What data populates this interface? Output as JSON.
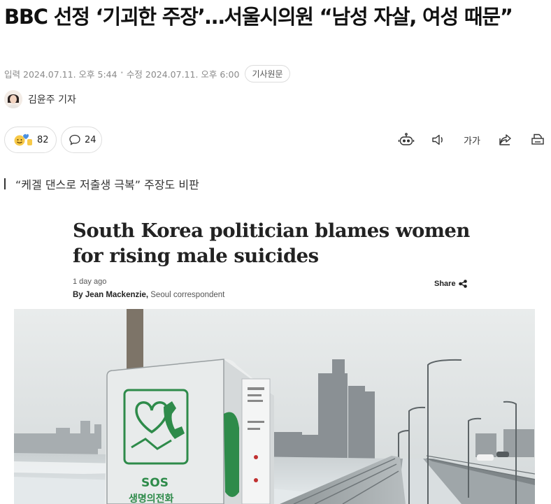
{
  "headline": "BBC 선정 ‘기괴한 주장’…서울시의원 “남성 자살, 여성 때문”",
  "meta": {
    "input_label": "입력",
    "input_time": "2024.07.11. 오후 5:44",
    "modified_label": "수정",
    "modified_time": "2024.07.11. 오후 6:00",
    "original_button": "기사원문"
  },
  "byline": {
    "reporter": "김윤주 기자"
  },
  "actions": {
    "reaction_count": "82",
    "comment_count": "24",
    "font_size_label": "가가"
  },
  "subheadline": "“케겔 댄스로 저출생 극복” 주장도 비판",
  "bbc_embed": {
    "title": "South Korea politician blames women for rising male suicides",
    "date": "1 day ago",
    "author_prefix": "By",
    "author_name": "Jean Mackenzie,",
    "author_role": "Seoul correspondent",
    "share_label": "Share"
  },
  "photo": {
    "phone_label": "SOS",
    "phone_sublabel": "생명의전화"
  },
  "colors": {
    "text_primary": "#111111",
    "text_muted": "#8a8a8a",
    "pill_border": "#dedede",
    "phone_green": "#2e8b4a"
  }
}
